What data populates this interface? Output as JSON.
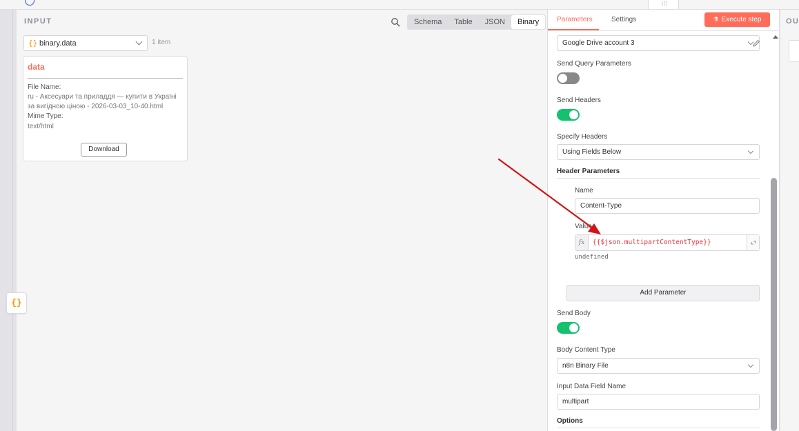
{
  "input_panel": {
    "title": "INPUT",
    "view_tabs": [
      "Schema",
      "Table",
      "JSON",
      "Binary"
    ],
    "active_view_tab": "Binary",
    "field_select": {
      "icon": "{}",
      "value": "binary.data"
    },
    "item_count": "1 item",
    "binary_card": {
      "name": "data",
      "file_name_label": "File Name:",
      "file_name": "ru - Аксесуари та приладдя — купити в Україні за вигідною ціною - 2026-03-03_10-40.html",
      "mime_label": "Mime Type:",
      "mime_value": "text/html",
      "download_label": "Download"
    }
  },
  "json_fab_label": "{}",
  "param_panel": {
    "tabs": [
      "Parameters",
      "Settings"
    ],
    "active_tab": "Parameters",
    "execute_label": "Execute step",
    "credential_value": "Google Drive account 3",
    "send_query_label": "Send Query Parameters",
    "send_query_enabled": false,
    "send_headers_label": "Send Headers",
    "send_headers_enabled": true,
    "specify_headers_label": "Specify Headers",
    "specify_headers_value": "Using Fields Below",
    "header_params_label": "Header Parameters",
    "name_label": "Name",
    "name_value": "Content-Type",
    "value_label": "Value",
    "fx_label": "fx",
    "value_expression": "{{$json.multipartContentType}}",
    "expression_result": "undefined",
    "add_parameter_label": "Add Parameter",
    "send_body_label": "Send Body",
    "send_body_enabled": true,
    "body_content_type_label": "Body Content Type",
    "body_content_type_value": "n8n Binary File",
    "input_data_field_label": "Input Data Field Name",
    "input_data_field_value": "multipart",
    "options_label": "Options"
  },
  "output_panel": {
    "title": "OUTPUT"
  },
  "colors": {
    "accent": "#ff6d5a",
    "toggle_on": "#13c16f",
    "expression": "#e0343c",
    "annotation_arrow": "#d21414"
  }
}
